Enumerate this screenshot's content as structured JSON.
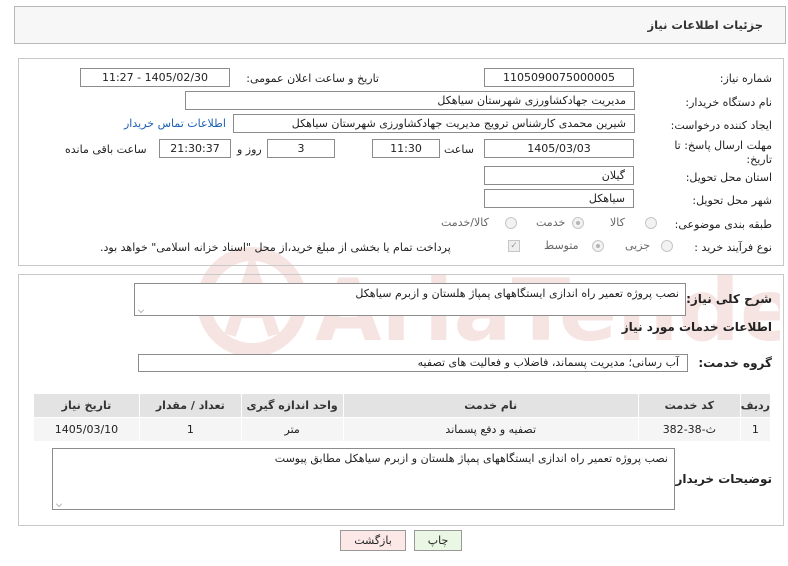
{
  "header": {
    "title": "جزئیات اطلاعات نیاز"
  },
  "form": {
    "need_number": {
      "label": "شماره نیاز:",
      "value": "1105090075000005"
    },
    "announce": {
      "label": "تاریخ و ساعت اعلان عمومی:",
      "value": "1405/02/30 - 11:27"
    },
    "buyer_org": {
      "label": "نام دستگاه خریدار:",
      "value": "مدیریت جهادکشاورزی شهرستان سیاهکل"
    },
    "requester": {
      "label": "ایجاد کننده درخواست:",
      "value": "شیرین محمدی کارشناس ترویج مدیریت جهادکشاورزی شهرستان سیاهکل",
      "contact_link": "اطلاعات تماس خریدار"
    },
    "deadline": {
      "label_line1": "مهلت ارسال پاسخ: تا",
      "label_line2": "تاریخ:",
      "date": "1405/03/03",
      "time_label": "ساعت",
      "time": "11:30",
      "days": "3",
      "days_label": "روز و",
      "remaining": "21:30:37",
      "remaining_label": "ساعت باقی مانده"
    },
    "province": {
      "label": "استان محل تحویل:",
      "value": "گیلان"
    },
    "city": {
      "label": "شهر محل تحویل:",
      "value": "سیاهکل"
    },
    "category": {
      "label": "طبقه بندی موضوعی:",
      "options": [
        "کالا",
        "خدمت",
        "کالا/خدمت"
      ],
      "selected": "خدمت"
    },
    "purchase_type": {
      "label": "نوع فرآیند خرید :",
      "options": [
        "جزیی",
        "متوسط"
      ],
      "selected": "متوسط",
      "payment_note": "پرداخت تمام یا بخشی از مبلغ خرید،از محل \"اسناد خزانه اسلامی\" خواهد بود."
    }
  },
  "description": {
    "label": "شرح کلی نیاز:",
    "value": "نصب پروژه تعمیر راه اندازی ایستگاههای پمپاژ هلستان و ازبرم سیاهکل"
  },
  "services": {
    "section_title": "اطلاعات خدمات مورد نیاز",
    "group_label": "گروه خدمت:",
    "group_value": "آب رسانی؛ مدیریت پسماند، فاضلاب و فعالیت های تصفیه",
    "columns": [
      "ردیف",
      "کد خدمت",
      "نام خدمت",
      "واحد اندازه گیری",
      "تعداد / مقدار",
      "تاریخ نیاز"
    ],
    "rows": [
      [
        "1",
        "ث-38-382",
        "تصفیه و دفع پسماند",
        "متر",
        "1",
        "1405/03/10"
      ]
    ]
  },
  "buyer_notes": {
    "label": "توضیحات خریدار:",
    "value": "نصب پروژه تعمیر راه اندازی ایستگاههای پمپاژ هلستان و ازبرم سیاهکل مطابق پیوست"
  },
  "buttons": {
    "print": "چاپ",
    "back": "بازگشت"
  },
  "watermark": {
    "text": "AriaTender.neT",
    "color": "#c0392b"
  }
}
